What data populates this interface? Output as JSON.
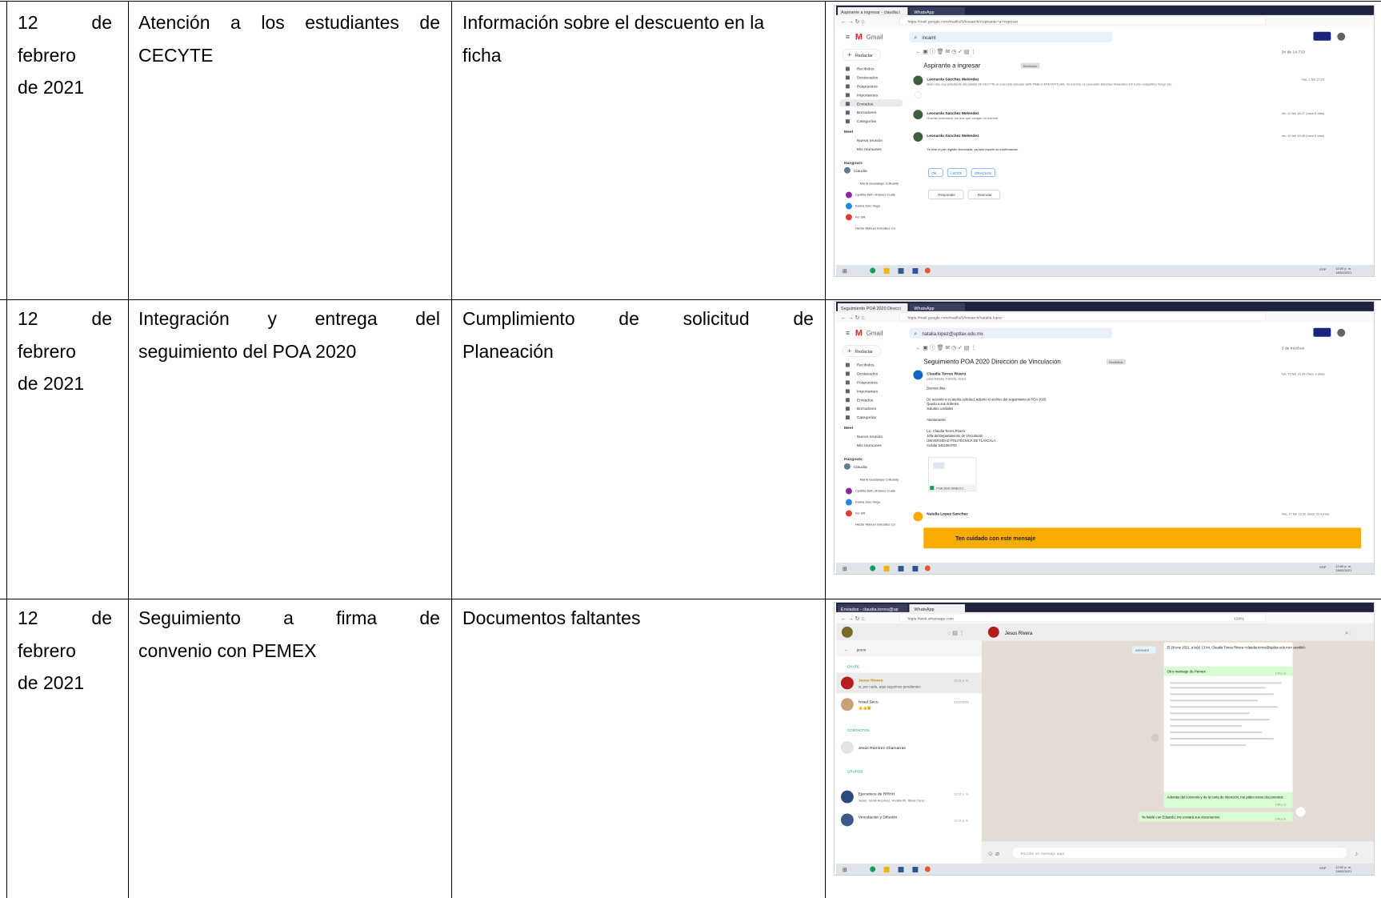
{
  "rows": [
    {
      "date": {
        "l1a": "12",
        "l1b": "de",
        "l2": "febrero",
        "l3": "de 2021"
      },
      "activity": {
        "l1": "Atención a los estudiantes de",
        "l2": "CECYTE"
      },
      "result": {
        "l1": "Información sobre el descuento en la",
        "l2": "ficha"
      },
      "screenshot": {
        "tabs": [
          "Aspirante a ingresar - claudia.t",
          "WhatsApp"
        ],
        "url": "https://mail.google.com/mail/u/0/#search/Aspirante+a+ingresar",
        "app": "Gmail",
        "search": "incaml",
        "compose": "Redactar",
        "nav": [
          "Recibidos",
          "Destacados",
          "Pospuestos",
          "Importantes",
          "Enviados",
          "Borradores",
          "Categorías"
        ],
        "meet": "Meet",
        "meet_items": [
          "Nueva reunión",
          "Mis reuniones"
        ],
        "hangouts": "Hangouts",
        "hangouts_user": "Claudia",
        "contacts": [
          "María Guadalupe Colluanty",
          "Cynthia Beth Jimenez Cuate",
          "Karina Soto Vega",
          "Fer SR",
          "Héctor Manuel González Ca"
        ],
        "pager": "34 de 14.733",
        "subject": "Aspirante a ingresar",
        "label": "Recibidos",
        "messages": [
          {
            "sender": "Leonardo Sánchez Melendez",
            "snippet": "Buen día, soy estudiante del plantel 08 CECYTE el cual esta ubicado SAN PABLO APETATITLAN, mi nombre es Leonardo Sánchez Melendez 8 F turno vespertino Tengo pre",
            "date": "mar, 2 feb 22:15"
          },
          {
            "sender": "Leonardo Sánchez Melendez",
            "snippet": "Gracias licenciada, los dos que carigan mi nombre",
            "date": "vie, 12 feb 16:37 (hace 6 días)"
          },
          {
            "sender": "Leonardo Sánchez Melendez",
            "snippet": "Ya hice el pre registro licenciada, ya solo espero su confirmación",
            "date": "vie, 12 feb 19:45 (hace 6 días)"
          }
        ],
        "smart_replies": [
          "OK.",
          "LISTO!",
          "GRACIAS!"
        ],
        "reply": "Responder",
        "forward": "Reenviar",
        "clock": "12:09 p. m.",
        "clock_date": "18/02/2021",
        "lang": "ESP"
      }
    },
    {
      "date": {
        "l1a": "12",
        "l1b": "de",
        "l2": "febrero",
        "l3": "de 2021"
      },
      "activity": {
        "l1a": "Integración",
        "l1b": "y",
        "l1c": "entrega",
        "l1d": "del",
        "l2": "seguimiento del POA 2020"
      },
      "result": {
        "l1a": "Cumplimiento",
        "l1b": "de",
        "l1c": "solicitud",
        "l1d": "de",
        "l2": "Planeación"
      },
      "screenshot": {
        "tabs": [
          "Seguimiento POA 2020 Direcci",
          "WhatsApp"
        ],
        "url": "https://mail.google.com/mail/u/0/#search/natalia.lopez",
        "app": "Gmail",
        "search": "natalia.lopez@uptlax.edu.mx",
        "compose": "Redactar",
        "nav": [
          "Recibidos",
          "Destacados",
          "Pospuestos",
          "Importantes",
          "Enviados",
          "Borradores",
          "Categorías"
        ],
        "meet": "Meet",
        "meet_items": [
          "Nueva reunión",
          "Mis reuniones"
        ],
        "hangouts": "Hangouts",
        "hangouts_user": "Claudia",
        "contacts": [
          "María Guadalupe Colluanty",
          "Cynthia Beth Jimenez Cuate",
          "Karina Soto Vega",
          "Fer SR",
          "Héctor Manuel González Ca"
        ],
        "pager": "3 de muchos",
        "subject": "Seguimiento POA 2020 Dirección de Vinculación",
        "label": "Recibidos",
        "sender": "Claudia Torres Rivera",
        "to": "para Natalia, Fabiola, Jesús",
        "body": [
          "Buenos días",
          "De acuerdo a su atenta solicitud, adjunto el archivo del seguimiento al POA 2020.",
          "Quedo a sus órdenes.",
          "Saludos cordiales",
          "Atentamente",
          "Lic. Claudia Torres Rivera",
          "Jefa del Departamento de Vinculación",
          "UNIVERSIDAD POLITÉCNICA DE TLAXCALA",
          "Celular 2461064763"
        ],
        "attachment": "POA 2020 DIRECCI...",
        "date": "lun, 15 feb 10:34 (hace 3 días)",
        "second_sender": "Natalia Lopez Sanchez",
        "second_date": "mié, 17 feb 13:32 (hace 23 horas)",
        "warning": "Ten cuidado con este mensaje",
        "clock": "12:09 p. m.",
        "clock_date": "18/02/2021",
        "lang": "ESP"
      }
    },
    {
      "date": {
        "l1a": "12",
        "l1b": "de",
        "l2": "febrero",
        "l3": "de 2021"
      },
      "activity": {
        "l1a": "Seguimiento",
        "l1b": "a",
        "l1c": "firma",
        "l1d": "de",
        "l2": "convenio con PEMEX"
      },
      "result": {
        "l1": "Documentos faltantes"
      },
      "screenshot": {
        "tabs": [
          "Enviados - claudia.torres@up",
          "WhatsApp"
        ],
        "url": "https://web.whatsapp.com",
        "zoom": "120%",
        "search": "jesus",
        "sections": [
          "CHATS",
          "CONTACTOS",
          "GRUPOS"
        ],
        "chats": [
          {
            "name": "Jesus Rivera",
            "preview": "si, por nada, aqui seguimos pendientes",
            "time": "12:31 p. m."
          },
          {
            "name": "Israel Secu",
            "preview": "👍👍😉",
            "time": "31/12/2020"
          }
        ],
        "contact": "Jesús Ramírez Chamarras",
        "groups": [
          {
            "name": "Ejecutivos de RRHH",
            "preview": "Jesús: Genis Arcomez, Horalia Ilh, Iliana Coral...",
            "time": "12:02 p. m."
          },
          {
            "name": "Vinculación y Difusión",
            "preview": "",
            "time": "12:22 p. m."
          }
        ],
        "header_name": "Jesus Rivera",
        "day": "VIERNES",
        "quote": "El 29 ene 2021, a la(s) 13:44, Claudia Torres Rivera <claudia.torres@uptlax.edu.mx> escribió:",
        "msg1": "Otro mensaje de Pemex",
        "msg1_time": "1:24 p. m.",
        "msg2": "Además del convenio y de la carta de intención, me piden estos documentos",
        "msg2_time": "1:40 p. m.",
        "msg3": "Ya hablé con Eduardo, me enviará sus documentos",
        "msg3_time": "1:40 p. m.",
        "input": "Escribe un mensaje aquí",
        "clock": "12:02 p. m.",
        "clock_date": "18/02/2021",
        "lang": "ESP"
      }
    }
  ]
}
